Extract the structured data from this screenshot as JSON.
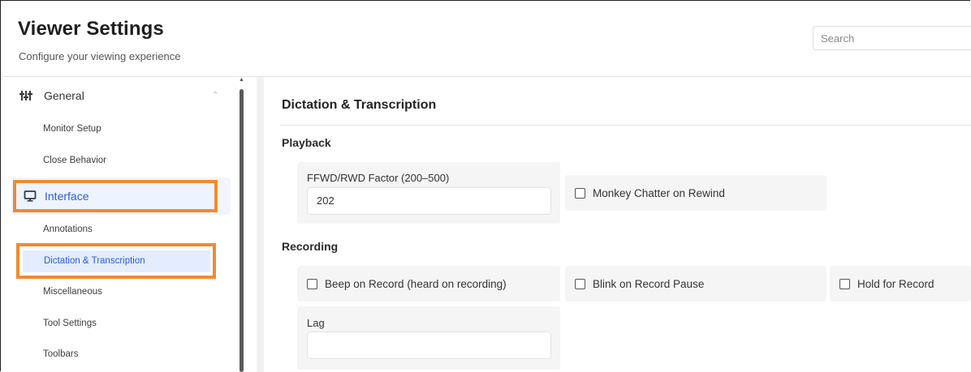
{
  "header": {
    "title": "Viewer Settings",
    "subtitle": "Configure your viewing experience",
    "search_placeholder": "Search"
  },
  "sidebar": {
    "group_label": "General",
    "items": [
      {
        "label": "Monitor Setup"
      },
      {
        "label": "Close Behavior"
      },
      {
        "label": "Interface"
      },
      {
        "label": "Annotations"
      },
      {
        "label": "Dictation & Transcription"
      },
      {
        "label": "Miscellaneous"
      },
      {
        "label": "Tool Settings"
      },
      {
        "label": "Toolbars"
      }
    ],
    "highlight_color": "#f28a2e",
    "active_color": "#2a5bd7"
  },
  "main": {
    "section_title": "Dictation & Transcription",
    "playback": {
      "title": "Playback",
      "ffwd_label": "FFWD/RWD Factor (200–500)",
      "ffwd_value": "202",
      "monkey_label": "Monkey Chatter on Rewind"
    },
    "recording": {
      "title": "Recording",
      "beep_label": "Beep on Record (heard on recording)",
      "blink_label": "Blink on Record Pause",
      "hold_label": "Hold for Record",
      "lag_label": "Lag",
      "lag_value": ""
    }
  }
}
